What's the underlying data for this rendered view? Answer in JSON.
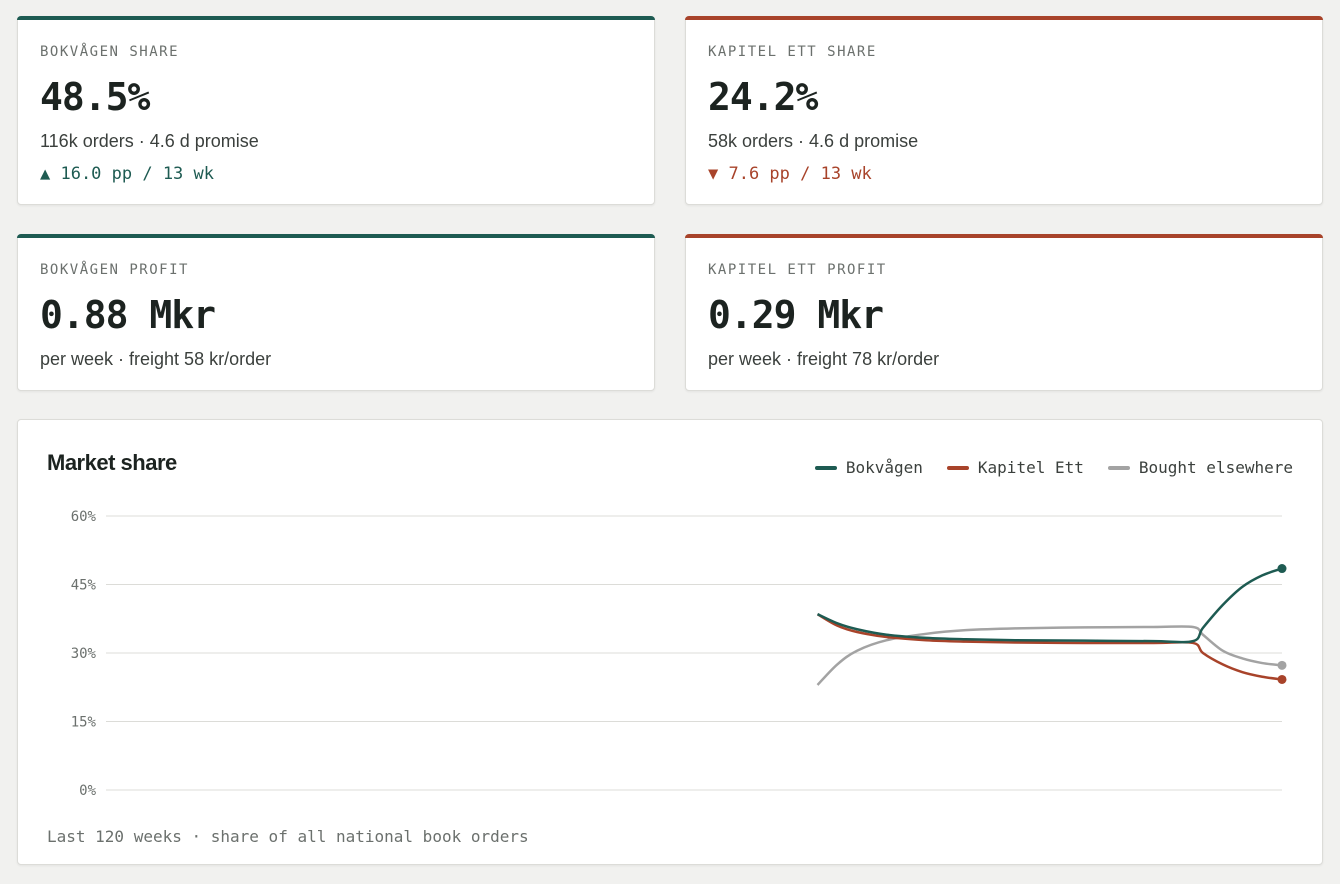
{
  "colors": {
    "bokvagen": "#1e5b52",
    "kapitel": "#a8432a",
    "elsewhere": "#a3a3a3"
  },
  "kpis": [
    {
      "label": "BOKVÅGEN SHARE",
      "value": "48.5%",
      "sub": "116k orders · 4.6 d promise",
      "delta": "▲ 16.0 pp / 13 wk",
      "trend": "up"
    },
    {
      "label": "KAPITEL ETT SHARE",
      "value": "24.2%",
      "sub": "58k orders · 4.6 d promise",
      "delta": "▼ 7.6 pp / 13 wk",
      "trend": "down"
    },
    {
      "label": "BOKVÅGEN PROFIT",
      "value": "0.88 Mkr",
      "sub": "per week · freight 58 kr/order"
    },
    {
      "label": "KAPITEL ETT PROFIT",
      "value": "0.29 Mkr",
      "sub": "per week · freight 78 kr/order"
    }
  ],
  "chart": {
    "title": "Market share",
    "footer": "Last 120 weeks · share of all national book orders"
  },
  "chart_data": {
    "type": "line",
    "title": "Market share",
    "xlabel": "",
    "ylabel": "",
    "x_range": [
      1,
      120
    ],
    "ylim": [
      0,
      60
    ],
    "y_ticks": [
      "0%",
      "15%",
      "30%",
      "45%",
      "60%"
    ],
    "grid": true,
    "legend_position": "top-right",
    "series": [
      {
        "name": "Bokvågen",
        "x": [
          73,
          75,
          77,
          80,
          84,
          88,
          93,
          100,
          107,
          111,
          112,
          114,
          116,
          118,
          120
        ],
        "y": [
          38.5,
          36.5,
          35.2,
          34.0,
          33.3,
          33.0,
          32.8,
          32.7,
          32.6,
          32.6,
          35.5,
          40.5,
          44.5,
          47.0,
          48.5
        ]
      },
      {
        "name": "Kapitel Ett",
        "x": [
          73,
          75,
          77,
          80,
          84,
          88,
          93,
          100,
          107,
          111,
          112,
          114,
          116,
          118,
          120
        ],
        "y": [
          38.5,
          36.0,
          34.6,
          33.5,
          32.8,
          32.5,
          32.3,
          32.2,
          32.2,
          32.2,
          30.0,
          27.5,
          25.8,
          24.8,
          24.2
        ]
      },
      {
        "name": "Bought elsewhere",
        "x": [
          73,
          75,
          77,
          80,
          84,
          88,
          93,
          100,
          107,
          111,
          112,
          114,
          116,
          118,
          120
        ],
        "y": [
          23.0,
          27.5,
          30.5,
          32.8,
          34.2,
          35.0,
          35.4,
          35.6,
          35.7,
          35.7,
          34.0,
          30.5,
          28.8,
          27.8,
          27.3
        ]
      }
    ]
  }
}
